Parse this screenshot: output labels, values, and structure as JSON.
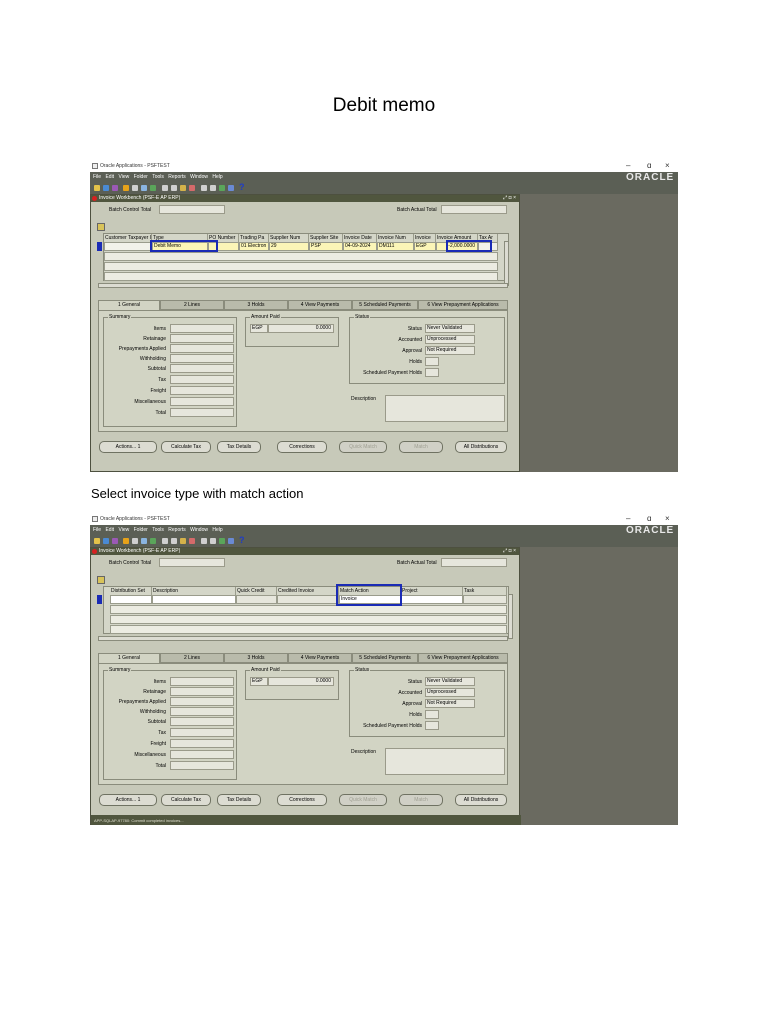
{
  "document": {
    "title": "Debit memo",
    "caption": "Select invoice type with match action"
  },
  "window": {
    "app_title": "Oracle Applications - PSFTEST",
    "minimize": "–",
    "restore": "ɑ",
    "close": "×",
    "brand": "ORACLE",
    "menu": [
      "File",
      "Edit",
      "View",
      "Folder",
      "Tools",
      "Reports",
      "Window",
      "Help"
    ],
    "help_icon": "?"
  },
  "form": {
    "title": "Invoice Workbench (PSF-E AP ERP)",
    "title_controls": "⤢ ⊡ ×",
    "batch_control_total_label": "Batch Control Total",
    "batch_actual_total_label": "Batch Actual Total"
  },
  "grid1": {
    "headers": [
      "Customer Taxpayer ID",
      "Type",
      "PO Number",
      "Trading Pa",
      "Supplier Num",
      "Supplier Site",
      "Invoice Date",
      "Invoice Num",
      "Invoice",
      "Invoice Amount",
      "Tax Ar"
    ],
    "row": [
      "",
      "Debit Memo",
      "",
      "01 Electron",
      "29",
      "PSP",
      "04-09-2024",
      "DM111",
      "EGP",
      "-2,000.0000",
      ""
    ]
  },
  "grid2": {
    "headers": [
      "Distribution Set",
      "Description",
      "Quick Credit",
      "Credited Invoice",
      "Match Action",
      "Project",
      "Task"
    ],
    "row": [
      "",
      "",
      "",
      "",
      "Invoice",
      "",
      ""
    ]
  },
  "tabs": [
    "1 General",
    "2 Lines",
    "3 Holds",
    "4 View Payments",
    "5 Scheduled Payments",
    "6 View Prepayment Applications"
  ],
  "summary": {
    "title": "Summary",
    "labels": [
      "Items",
      "Retainage",
      "Prepayments Applied",
      "Withholding",
      "Subtotal",
      "Tax",
      "Freight",
      "Miscellaneous",
      "Total"
    ]
  },
  "amount_paid": {
    "title": "Amount Paid",
    "currency": "EGP",
    "value": "0.0000"
  },
  "status": {
    "title": "Status",
    "labels": [
      "Status",
      "Accounted",
      "Approval",
      "Holds",
      "Scheduled Payment Holds"
    ],
    "values": [
      "Never Validated",
      "Unprocessed",
      "Not Required",
      "",
      ""
    ],
    "description_label": "Description"
  },
  "buttons": [
    "Actions... 1",
    "Calculate Tax",
    "Tax Details",
    "Corrections",
    "Quick Match",
    "Match",
    "All Distributions"
  ],
  "statusbar2": "APP-SQLAP-97780: Commit completed invoices..."
}
